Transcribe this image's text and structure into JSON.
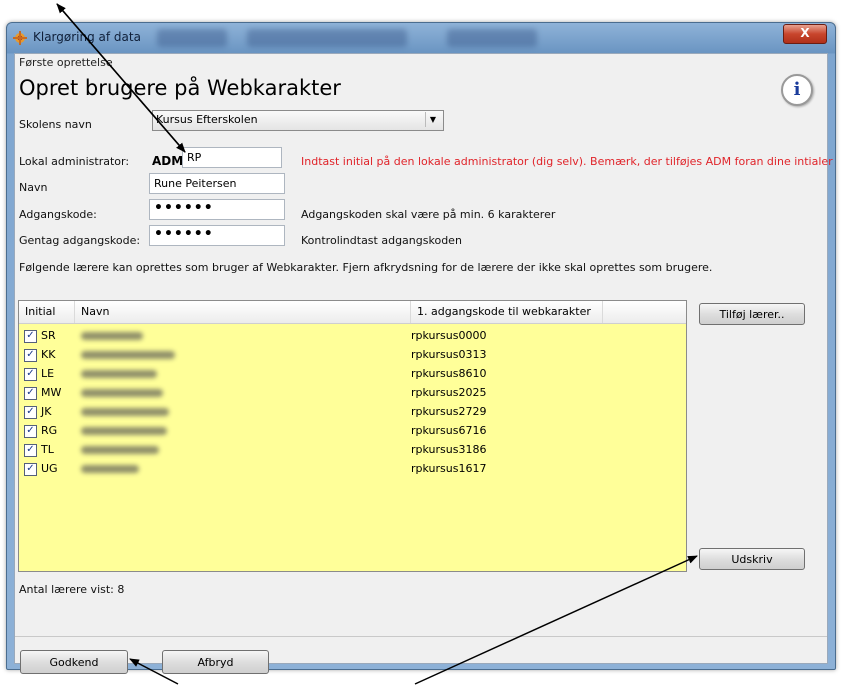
{
  "window": {
    "title": "Klargøring af data",
    "close_label": "X"
  },
  "section_label": "Første oprettelse",
  "page_title": "Opret brugere på Webkarakter",
  "info_icon_label": "i",
  "school": {
    "label": "Skolens navn",
    "selected": "Kursus Efterskolen"
  },
  "admin": {
    "label": "Lokal administrator:",
    "prefix": "ADM",
    "value": "RP",
    "hint": "Indtast initial på den lokale administrator (dig selv). Bemærk, der tilføjes ADM foran dine intialer"
  },
  "name": {
    "label": "Navn",
    "value": "Rune Peitersen"
  },
  "password": {
    "label": "Adgangskode:",
    "value": "••••••",
    "hint": "Adgangskoden skal være på min. 6 karakterer"
  },
  "password_repeat": {
    "label": "Gentag adgangskode:",
    "value": "••••••",
    "hint": "Kontrolindtast adgangskoden"
  },
  "teachers_info": "Følgende lærere kan oprettes som bruger af Webkarakter. Fjern afkrydsning for de lærere der ikke skal oprettes som brugere.",
  "table": {
    "headers": [
      "Initial",
      "Navn",
      "1. adgangskode til webkarakter"
    ],
    "rows": [
      {
        "checked": true,
        "initial": "SR",
        "password": "rpkursus0000"
      },
      {
        "checked": true,
        "initial": "KK",
        "password": "rpkursus0313"
      },
      {
        "checked": true,
        "initial": "LE",
        "password": "rpkursus8610"
      },
      {
        "checked": true,
        "initial": "MW",
        "password": "rpkursus2025"
      },
      {
        "checked": true,
        "initial": "JK",
        "password": "rpkursus2729"
      },
      {
        "checked": true,
        "initial": "RG",
        "password": "rpkursus6716"
      },
      {
        "checked": true,
        "initial": "TL",
        "password": "rpkursus3186"
      },
      {
        "checked": true,
        "initial": "UG",
        "password": "rpkursus1617"
      }
    ]
  },
  "buttons": {
    "add_teacher": "Tilføj lærer..",
    "print": "Udskriv",
    "approve": "Godkend",
    "cancel": "Afbryd"
  },
  "count_label": "Antal lærere vist: 8",
  "colors": {
    "grid_background": "#ffff99",
    "hint_red": "#e0242a"
  }
}
